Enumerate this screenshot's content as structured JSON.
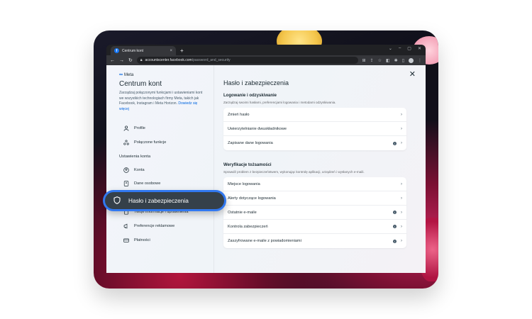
{
  "browser": {
    "tab_title": "Centrum kont",
    "tab_close": "×",
    "new_tab": "+",
    "url_host": "accountscenter.facebook.com",
    "url_path": "/password_and_security"
  },
  "sidebar": {
    "brand": "Meta",
    "title": "Centrum kont",
    "description": "Zarządzaj połączonymi funkcjami i ustawieniami kont we wszystkich technologiach firmy Meta, takich jak Facebook, Instagram i Meta Horizon.",
    "learn_more": "Dowiedz się więcej",
    "items_top": [
      {
        "label": "Profile"
      },
      {
        "label": "Połączone funkcje"
      }
    ],
    "section_label": "Ustawienia konta",
    "items_account": [
      {
        "label": "Konta"
      },
      {
        "label": "Dane osobowe"
      },
      {
        "label": "Hasło i zabezpieczenia"
      },
      {
        "label": "Twoje informacje i uprawnienia"
      },
      {
        "label": "Preferencje reklamowe"
      },
      {
        "label": "Płatności"
      }
    ]
  },
  "main": {
    "title": "Hasło i zabezpieczenia",
    "close": "✕",
    "login_group": {
      "title": "Logowanie i odzyskiwanie",
      "description": "Zarządzaj swoimi hasłami, preferencjami logowania i metodami odzyskiwania.",
      "rows": [
        {
          "label": "Zmień hasło"
        },
        {
          "label": "Uwierzytelnianie dwuskładnikowe"
        },
        {
          "label": "Zapisane dane logowania"
        }
      ]
    },
    "verify_group": {
      "title": "Weryfikacje tożsamości",
      "description": "Sprawdź problem z bezpieczeństwem, wykonując kontrolę aplikacji, urządzeń i wysłanych e-maili.",
      "rows": [
        {
          "label": "Miejsce logowania"
        },
        {
          "label": "Alerty dotyczące logowania"
        },
        {
          "label": "Ostatnie e-maile"
        },
        {
          "label": "Kontrola zabezpieczeń"
        },
        {
          "label": "Zaszyfrowane e-maile z powiadomieniami"
        }
      ]
    }
  },
  "highlight": {
    "label": "Hasło i zabezpieczenia"
  },
  "colors": {
    "accent": "#3178f0",
    "meta_blue": "#0064e0",
    "pill_bg": "#35404a"
  }
}
